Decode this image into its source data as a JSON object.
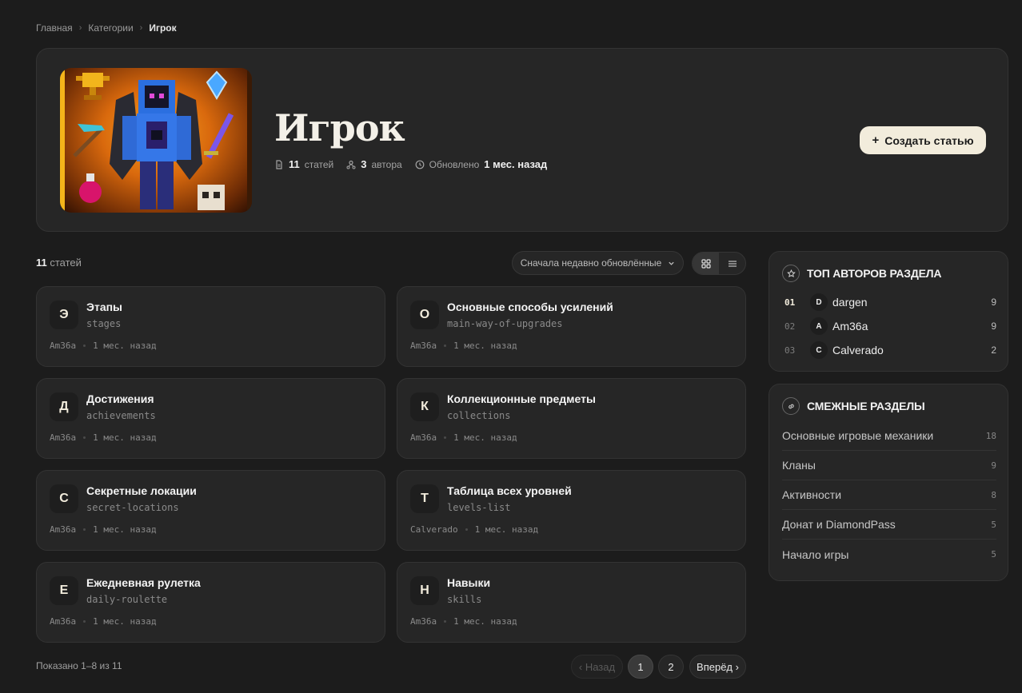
{
  "breadcrumb": {
    "items": [
      "Главная",
      "Категории"
    ],
    "current": "Игрок"
  },
  "hero": {
    "title": "Игрок",
    "articles_count": "11",
    "articles_label": "статей",
    "authors_count": "3",
    "authors_label": "автора",
    "updated_label": "Обновлено",
    "updated_value": "1 мес. назад",
    "create_button": "Создать статью"
  },
  "list": {
    "count": "11",
    "count_label": "статей",
    "sort_label": "Сначала недавно обновлённые"
  },
  "articles": [
    {
      "letter": "Э",
      "title": "Этапы",
      "slug": "stages",
      "author": "Am36a",
      "time": "1 мес. назад"
    },
    {
      "letter": "О",
      "title": "Основные способы усилений",
      "slug": "main-way-of-upgrades",
      "author": "Am36a",
      "time": "1 мес. назад"
    },
    {
      "letter": "Д",
      "title": "Достижения",
      "slug": "achievements",
      "author": "Am36a",
      "time": "1 мес. назад"
    },
    {
      "letter": "К",
      "title": "Коллекционные предметы",
      "slug": "collections",
      "author": "Am36a",
      "time": "1 мес. назад"
    },
    {
      "letter": "С",
      "title": "Секретные локации",
      "slug": "secret-locations",
      "author": "Am36a",
      "time": "1 мес. назад"
    },
    {
      "letter": "Т",
      "title": "Таблица всех уровней",
      "slug": "levels-list",
      "author": "Calverado",
      "time": "1 мес. назад"
    },
    {
      "letter": "Е",
      "title": "Ежедневная рулетка",
      "slug": "daily-roulette",
      "author": "Am36a",
      "time": "1 мес. назад"
    },
    {
      "letter": "Н",
      "title": "Навыки",
      "slug": "skills",
      "author": "Am36a",
      "time": "1 мес. назад"
    }
  ],
  "pagination": {
    "shown": "Показано 1–8 из 11",
    "prev": "‹ Назад",
    "pages": [
      "1",
      "2"
    ],
    "current": "1",
    "next": "Вперёд ›"
  },
  "top_authors": {
    "title": "ТОП АВТОРОВ РАЗДЕЛА",
    "items": [
      {
        "rank": "01",
        "initial": "D",
        "name": "dargen",
        "count": "9"
      },
      {
        "rank": "02",
        "initial": "A",
        "name": "Am36a",
        "count": "9"
      },
      {
        "rank": "03",
        "initial": "C",
        "name": "Calverado",
        "count": "2"
      }
    ]
  },
  "related": {
    "title": "СМЕЖНЫЕ РАЗДЕЛЫ",
    "items": [
      {
        "name": "Основные игровые механики",
        "count": "18"
      },
      {
        "name": "Кланы",
        "count": "9"
      },
      {
        "name": "Активности",
        "count": "8"
      },
      {
        "name": "Донат и DiamondPass",
        "count": "5"
      },
      {
        "name": "Начало игры",
        "count": "5"
      }
    ]
  },
  "colors": {
    "background": "#1c1c1c",
    "card": "#262626",
    "accent": "#f2ecdc"
  }
}
